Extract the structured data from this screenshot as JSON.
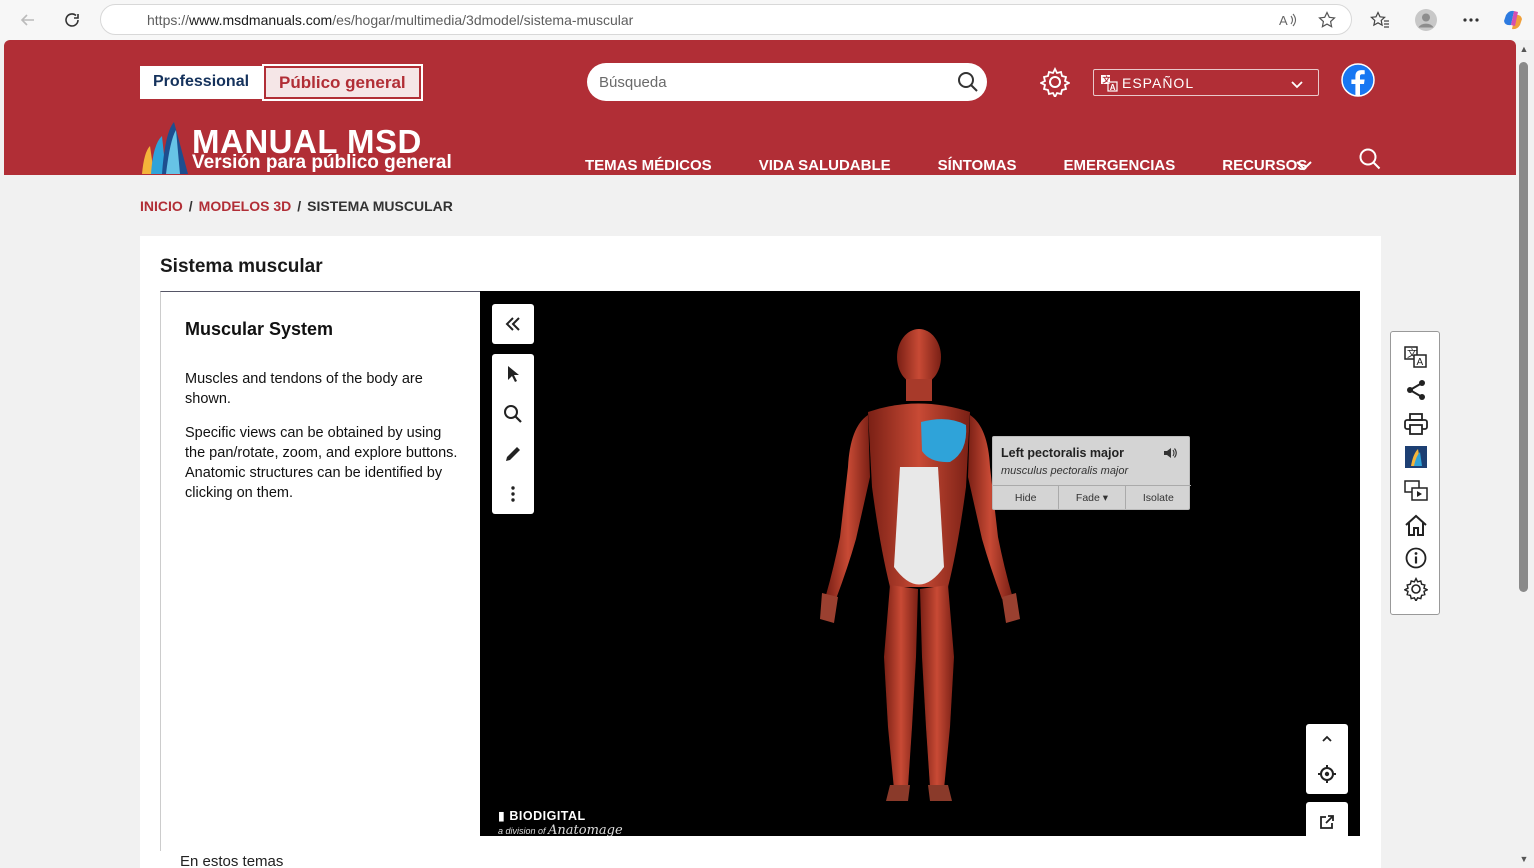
{
  "browser": {
    "url_prefix": "https://",
    "url_host": "www.msdmanuals.com",
    "url_path": "/es/hogar/multimedia/3dmodel/sistema-muscular"
  },
  "header": {
    "audience_professional": "Professional",
    "audience_public": "Público general",
    "search_placeholder": "Búsqueda",
    "language": "ESPAÑOL",
    "logo_title": "MANUAL MSD",
    "logo_subtitle": "Versión para público general",
    "nav": [
      "TEMAS MÉDICOS",
      "VIDA SALUDABLE",
      "SÍNTOMAS",
      "EMERGENCIAS",
      "RECURSOS"
    ]
  },
  "breadcrumb": {
    "home": "INICIO",
    "section": "MODELOS 3D",
    "current": "SISTEMA MUSCULAR",
    "separator": "/"
  },
  "content": {
    "page_title": "Sistema muscular",
    "panel_title": "Muscular System",
    "panel_p1": "Muscles and tendons of the body are shown.",
    "panel_p2": "Specific views can be obtained by using the pan/rotate, zoom, and explore buttons. Anatomic structures can be identified by clicking on them.",
    "related_heading": "En estos temas"
  },
  "viewer": {
    "selected_name": "Left pectoralis major",
    "selected_latin": "musculus pectoralis major",
    "action_hide": "Hide",
    "action_fade": "Fade",
    "action_isolate": "Isolate",
    "brand": "BIODIGITAL",
    "brand_sub_prefix": "a division of",
    "brand_sub_name": "Anatomage"
  },
  "colors": {
    "brand_red": "#b12e36",
    "highlight_muscle": "#2fa3d9"
  }
}
